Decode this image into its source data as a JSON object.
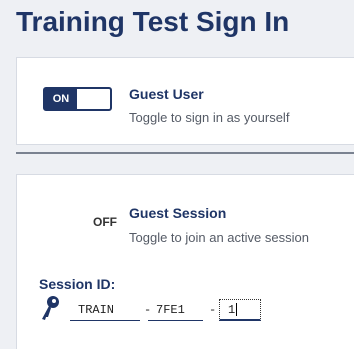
{
  "page": {
    "title": "Training Test Sign In"
  },
  "guest_user": {
    "toggle_state": "ON",
    "title": "Guest User",
    "description": "Toggle to sign in as yourself"
  },
  "guest_session": {
    "toggle_state": "OFF",
    "title": "Guest Session",
    "description": "Toggle to join an active session"
  },
  "session": {
    "label": "Session ID:",
    "part1": "TRAIN",
    "part2": "7FE1",
    "part3": "1",
    "separator": "-"
  },
  "colors": {
    "accent": "#1f3566",
    "background": "#eef0f4"
  },
  "icons": {
    "session": "key-icon"
  }
}
